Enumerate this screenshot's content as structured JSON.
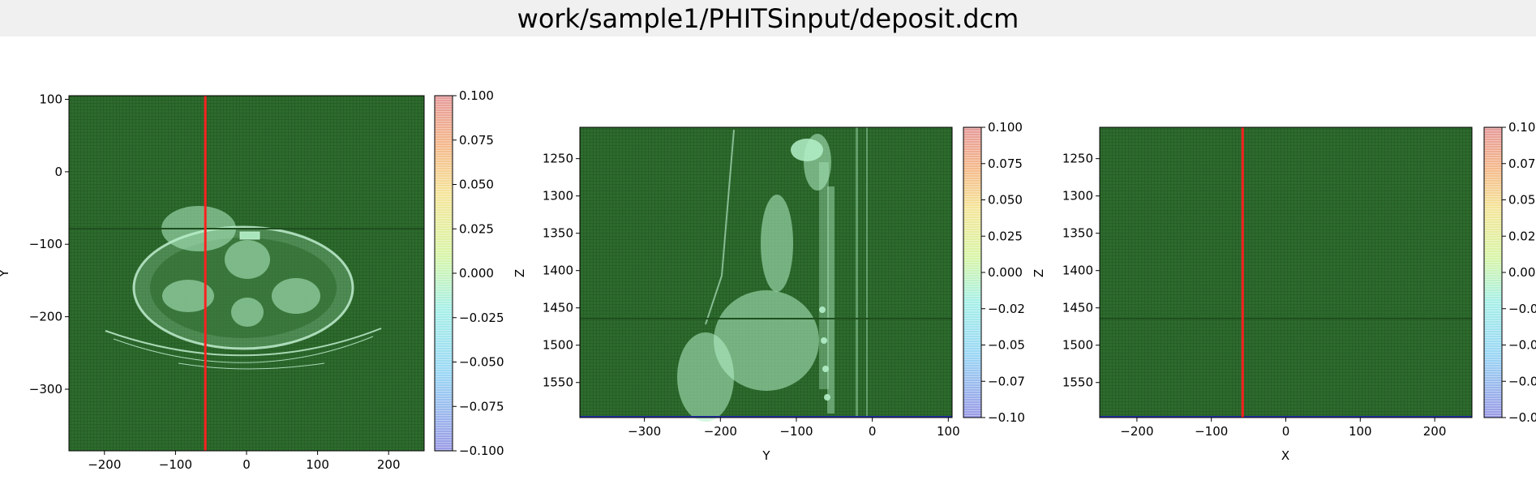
{
  "window": {
    "title": "work/sample1/PHITSinput/deposit.dcm"
  },
  "colors": {
    "overlay_green": "#2d6b2d",
    "grid_dark": "#1f4f1f",
    "anatomy": "#b4f0c8",
    "marker_line": "#ff2020",
    "bottom_edge": "#1f2fa8"
  },
  "chart_data": [
    {
      "type": "heatmap",
      "view": "axial",
      "xlabel": "",
      "ylabel": "Y",
      "xlim": [
        -250,
        250
      ],
      "ylim": [
        105,
        -385
      ],
      "xticks": [
        -200,
        -100,
        0,
        100,
        200
      ],
      "yticks": [
        -300,
        -200,
        -100,
        0,
        100
      ],
      "marker_x": -58,
      "colorbar": {
        "min": -0.1,
        "max": 0.1,
        "ticks": [
          0.1,
          0.075,
          0.05,
          0.025,
          0.0,
          -0.025,
          -0.05,
          -0.075,
          -0.1
        ],
        "tick_labels": [
          "0.100",
          "0.075",
          "0.050",
          "0.025",
          "0.000",
          "−0.025",
          "−0.050",
          "−0.075",
          "−0.100"
        ]
      }
    },
    {
      "type": "heatmap",
      "view": "sagittal",
      "xlabel": "Y",
      "ylabel": "Z",
      "xlim": [
        -385,
        105
      ],
      "ylim": [
        1208,
        1597
      ],
      "xticks": [
        -300,
        -200,
        -100,
        0,
        100
      ],
      "yticks": [
        1250,
        1300,
        1350,
        1400,
        1450,
        1500,
        1550
      ],
      "colorbar": {
        "min": -0.1,
        "max": 0.1,
        "ticks": [
          0.1,
          0.075,
          0.05,
          0.025,
          0.0,
          -0.025,
          -0.05,
          -0.075,
          -0.1
        ],
        "tick_labels": [
          "0.100",
          "0.075",
          "0.050",
          "0.025",
          "0.000",
          "−0.02",
          "−0.05",
          "−0.07",
          "−0.10"
        ]
      }
    },
    {
      "type": "heatmap",
      "view": "coronal",
      "xlabel": "X",
      "ylabel": "Z",
      "xlim": [
        -250,
        250
      ],
      "ylim": [
        1208,
        1597
      ],
      "xticks": [
        -200,
        -100,
        0,
        100,
        200
      ],
      "yticks": [
        1250,
        1300,
        1350,
        1400,
        1450,
        1500,
        1550
      ],
      "marker_x": -58,
      "colorbar": {
        "min": -0.1,
        "max": 0.1,
        "ticks": [
          0.1,
          0.075,
          0.05,
          0.025,
          0.0,
          -0.025,
          -0.05,
          -0.075,
          -0.1
        ],
        "tick_labels": [
          "0.10",
          "0.07",
          "0.05",
          "0.02",
          "0.00",
          "−0.0",
          "−0.0",
          "−0.0",
          "−0.0"
        ]
      }
    }
  ]
}
